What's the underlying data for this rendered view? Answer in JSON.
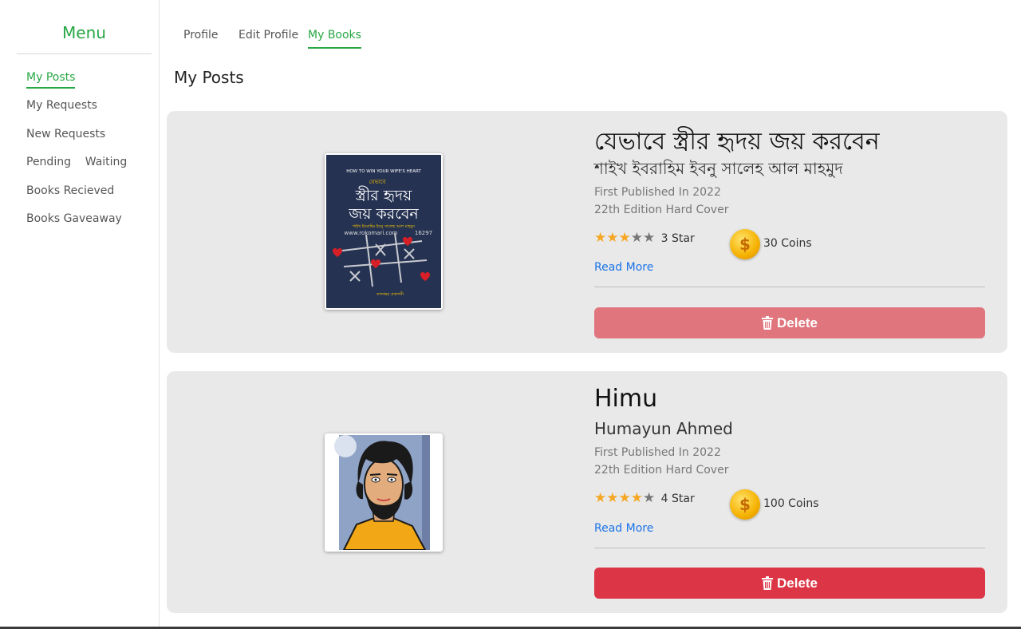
{
  "sidebar": {
    "title": "Menu",
    "items": [
      {
        "label": "My Posts"
      },
      {
        "label": "My Requests"
      },
      {
        "label": "New Requests"
      },
      {
        "label": "Pending    Waiting"
      },
      {
        "label": "Books Recieved"
      },
      {
        "label": "Books Gaveaway"
      }
    ]
  },
  "tabs": [
    {
      "label": "Profile"
    },
    {
      "label": "Edit Profile"
    },
    {
      "label": "My Books"
    }
  ],
  "page_title": "My Posts",
  "posts": [
    {
      "title": "যেভাবে স্ত্রীর হৃদয় জয় করবেন",
      "author": "শাইখ ইবরাহিম ইবনু সালেহ আল মাহমুদ",
      "published": "First Published In 2022",
      "edition": "22th Edition Hard Cover",
      "rating": 3,
      "rating_text": "3 Star",
      "coins_text": "30 Coins",
      "read_more": "Read More",
      "delete_label": "Delete",
      "cover": {
        "top_text": "HOW TO WIN YOUR WIFE'S HEART",
        "small_label": "যেভাবে",
        "line1": "স্ত্রীর হৃদয়",
        "line2": "জয় করবেন",
        "author_line": "শাইখ ইবরাহিম ইবনু সালেহ আল মাহমুদ",
        "site": "www.rokomari.com",
        "code": "16297",
        "publisher": "কালান্তর প্রকাশনী"
      }
    },
    {
      "title": "Himu",
      "author": "Humayun Ahmed",
      "published": "First Published In 2022",
      "edition": "22th Edition Hard Cover",
      "rating": 4,
      "rating_text": "4 Star",
      "coins_text": "100 Coins",
      "read_more": "Read More",
      "delete_label": "Delete"
    }
  ],
  "colors": {
    "accent": "#28a745",
    "delete_faded": "#e0757d",
    "delete_solid": "#dc3545",
    "link": "#1a73e8",
    "star": "#f5a623"
  },
  "icons": {
    "star": "star-icon",
    "coin": "coin-icon",
    "delete": "trash-icon"
  }
}
